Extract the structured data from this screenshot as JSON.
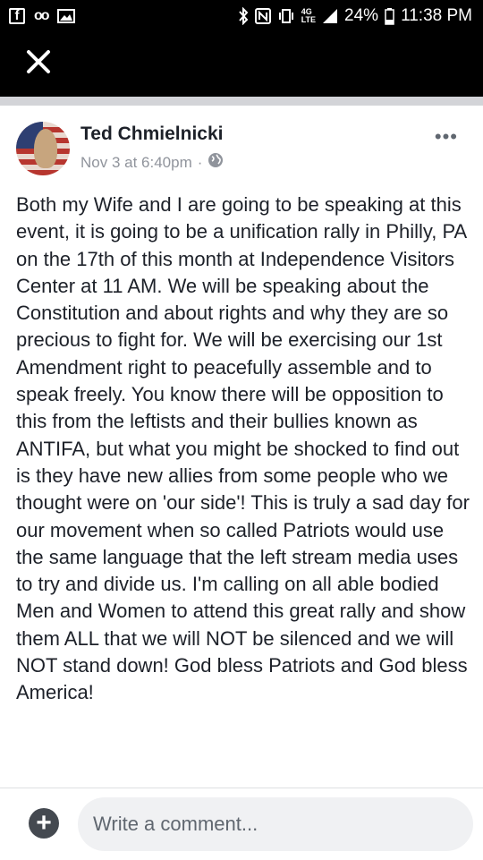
{
  "status_bar": {
    "left_icons": [
      "facebook-icon",
      "voicemail-icon",
      "image-icon"
    ],
    "right_icons": [
      "bluetooth-icon",
      "nfc-icon",
      "vibrate-icon",
      "4g-lte-icon",
      "signal-icon",
      "battery-icon"
    ],
    "battery": "24%",
    "time": "11:38 PM"
  },
  "header": {
    "close_icon": "close-icon"
  },
  "post": {
    "author": "Ted Chmielnicki",
    "timestamp": "Nov 3 at 6:40pm",
    "separator": "·",
    "privacy_icon": "globe-icon",
    "more_label": "•••",
    "text": "Both my Wife and I are going to be speaking at this event, it is going to be a unification rally in Philly, PA on the 17th of this month at Independence Visitors Center at 11 AM.  We will be speaking about the Constitution and about rights and why they are so precious to fight for.   We will be exercising our 1st Amendment right to peacefully assemble and to speak freely.  You know there will be opposition to this from the leftists and their bullies known as ANTIFA, but what you might be shocked to find out is they have new allies from some people who we thought were on 'our side'!  This is truly a sad day for our movement when so called Patriots would use the same language that the left stream media uses to try and divide us.  I'm calling on all able bodied Men and Women to attend this great rally and show them ALL that we will NOT be silenced and we will NOT stand down!  God bless Patriots and God bless America!"
  },
  "comment_bar": {
    "add_label": "+",
    "placeholder": "Write a comment..."
  },
  "colors": {
    "status_bg": "#000000",
    "text_primary": "#1d2129",
    "text_secondary": "#90949c",
    "input_bg": "#f0f1f3"
  }
}
